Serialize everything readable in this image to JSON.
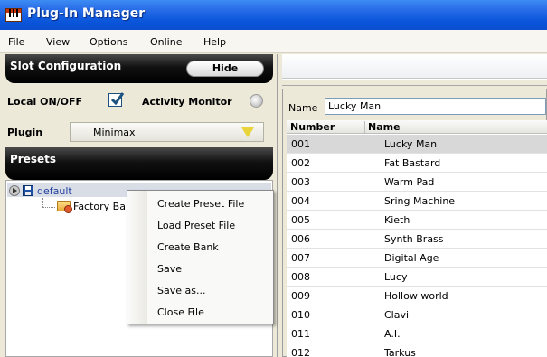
{
  "window": {
    "title": "Plug-In Manager"
  },
  "menubar": {
    "items": [
      "File",
      "View",
      "Options",
      "Online",
      "Help"
    ]
  },
  "slot_configuration": {
    "title": "Slot Configuration",
    "hide_label": "Hide",
    "local_label": "Local ON/OFF",
    "local_checked": true,
    "activity_label": "Activity Monitor",
    "plugin_label": "Plugin",
    "plugin_value": "Minimax"
  },
  "presets": {
    "title": "Presets",
    "tree": {
      "root": "default",
      "child": "Factory Bank"
    }
  },
  "context_menu": {
    "items": [
      "Create Preset File",
      "Load Preset File",
      "Create Bank",
      "Save",
      "Save as...",
      "Close File"
    ]
  },
  "preset_list": {
    "name_label": "Name",
    "name_value": "Lucky Man",
    "columns": [
      "Number",
      "Name"
    ],
    "rows": [
      {
        "number": "001",
        "name": "Lucky Man"
      },
      {
        "number": "002",
        "name": "Fat Bastard"
      },
      {
        "number": "003",
        "name": "Warm Pad"
      },
      {
        "number": "004",
        "name": "Sring Machine"
      },
      {
        "number": "005",
        "name": "Kieth"
      },
      {
        "number": "006",
        "name": "Synth Brass"
      },
      {
        "number": "007",
        "name": "Digital Age"
      },
      {
        "number": "008",
        "name": "Lucy"
      },
      {
        "number": "009",
        "name": "Hollow world"
      },
      {
        "number": "010",
        "name": "Clavi"
      },
      {
        "number": "011",
        "name": "A.I."
      },
      {
        "number": "012",
        "name": "Tarkus"
      }
    ],
    "selected_index": 0
  },
  "colors": {
    "titlebar": "#0a56dc",
    "panel_header": "#000000",
    "selection": "#d8d8d8",
    "check": "#1c5180"
  },
  "icons": {
    "app": "keyboard-icon",
    "expander": "expand-arrow-icon",
    "disk": "floppy-disk-icon",
    "bank": "folder-bank-icon",
    "dropdown": "dropdown-arrow-icon"
  }
}
